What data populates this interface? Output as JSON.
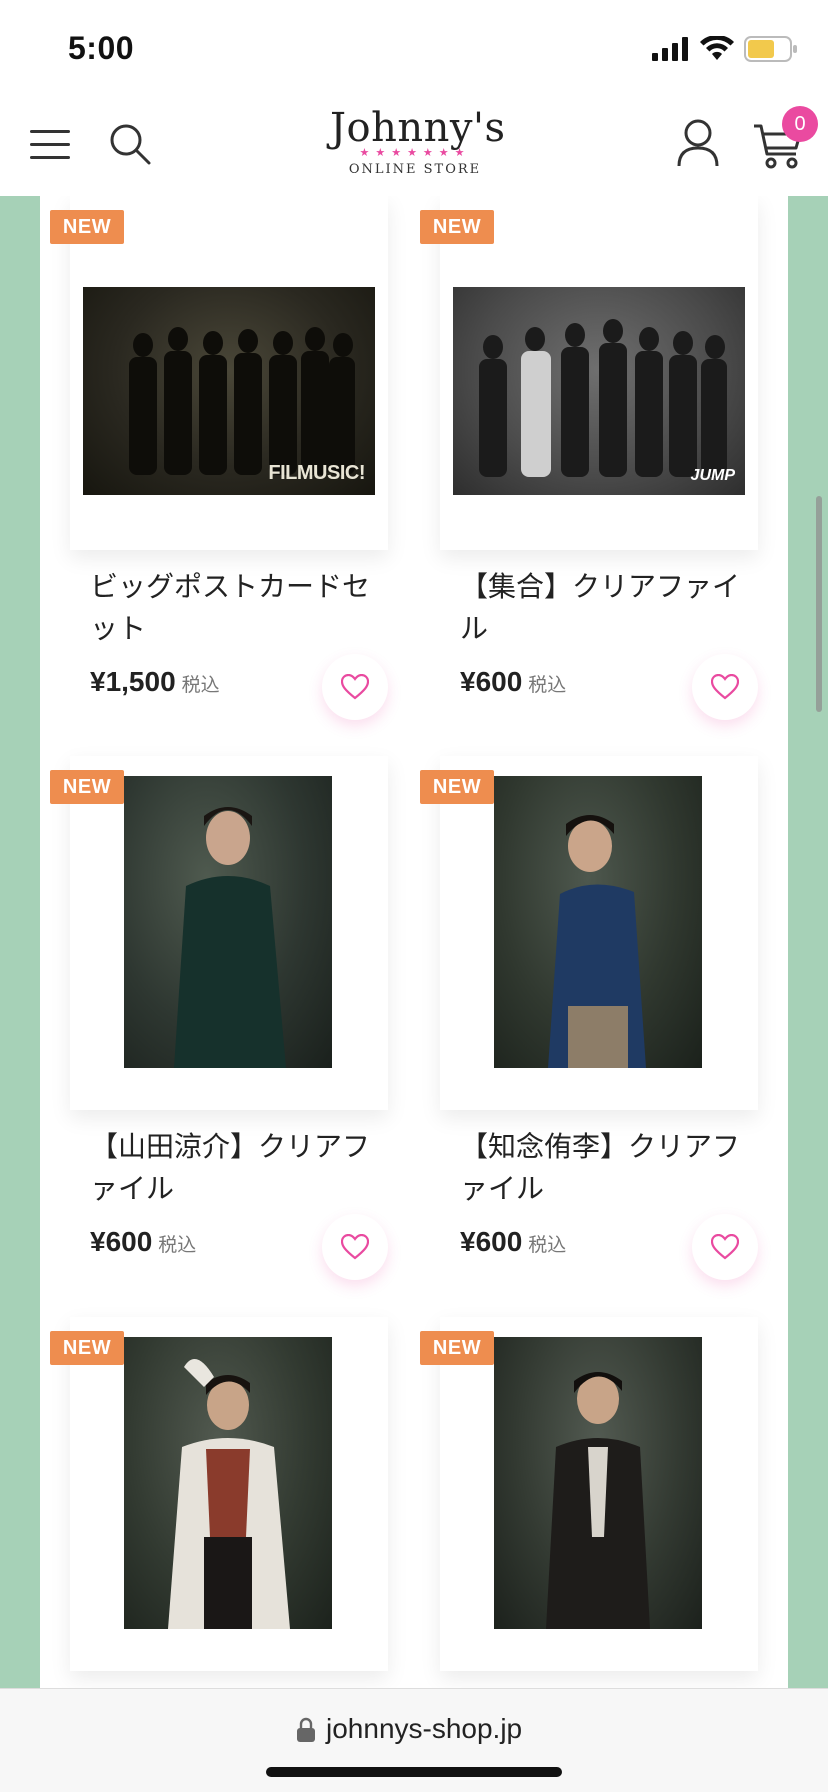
{
  "status_bar": {
    "time": "5:00"
  },
  "header": {
    "logo_main": "Johnny's",
    "logo_sub": "ONLINE STORE",
    "cart_count": "0"
  },
  "products": [
    {
      "badge": "NEW",
      "title": "ビッグポストカードセット",
      "price": "¥1,500",
      "tax": "税込",
      "photo_text": "FILMUSIC!"
    },
    {
      "badge": "NEW",
      "title": "【集合】クリアファイル",
      "price": "¥600",
      "tax": "税込",
      "photo_text": "JUMP"
    },
    {
      "badge": "NEW",
      "title": "【山田涼介】クリアファイル",
      "price": "¥600",
      "tax": "税込"
    },
    {
      "badge": "NEW",
      "title": "【知念侑李】クリアファイル",
      "price": "¥600",
      "tax": "税込"
    },
    {
      "badge": "NEW"
    },
    {
      "badge": "NEW"
    }
  ],
  "url_bar": {
    "url": "johnnys-shop.jp"
  },
  "colors": {
    "accent_pink": "#ea4aa0",
    "badge_orange": "#ee8d4f",
    "side_green": "#a6d1b7"
  }
}
